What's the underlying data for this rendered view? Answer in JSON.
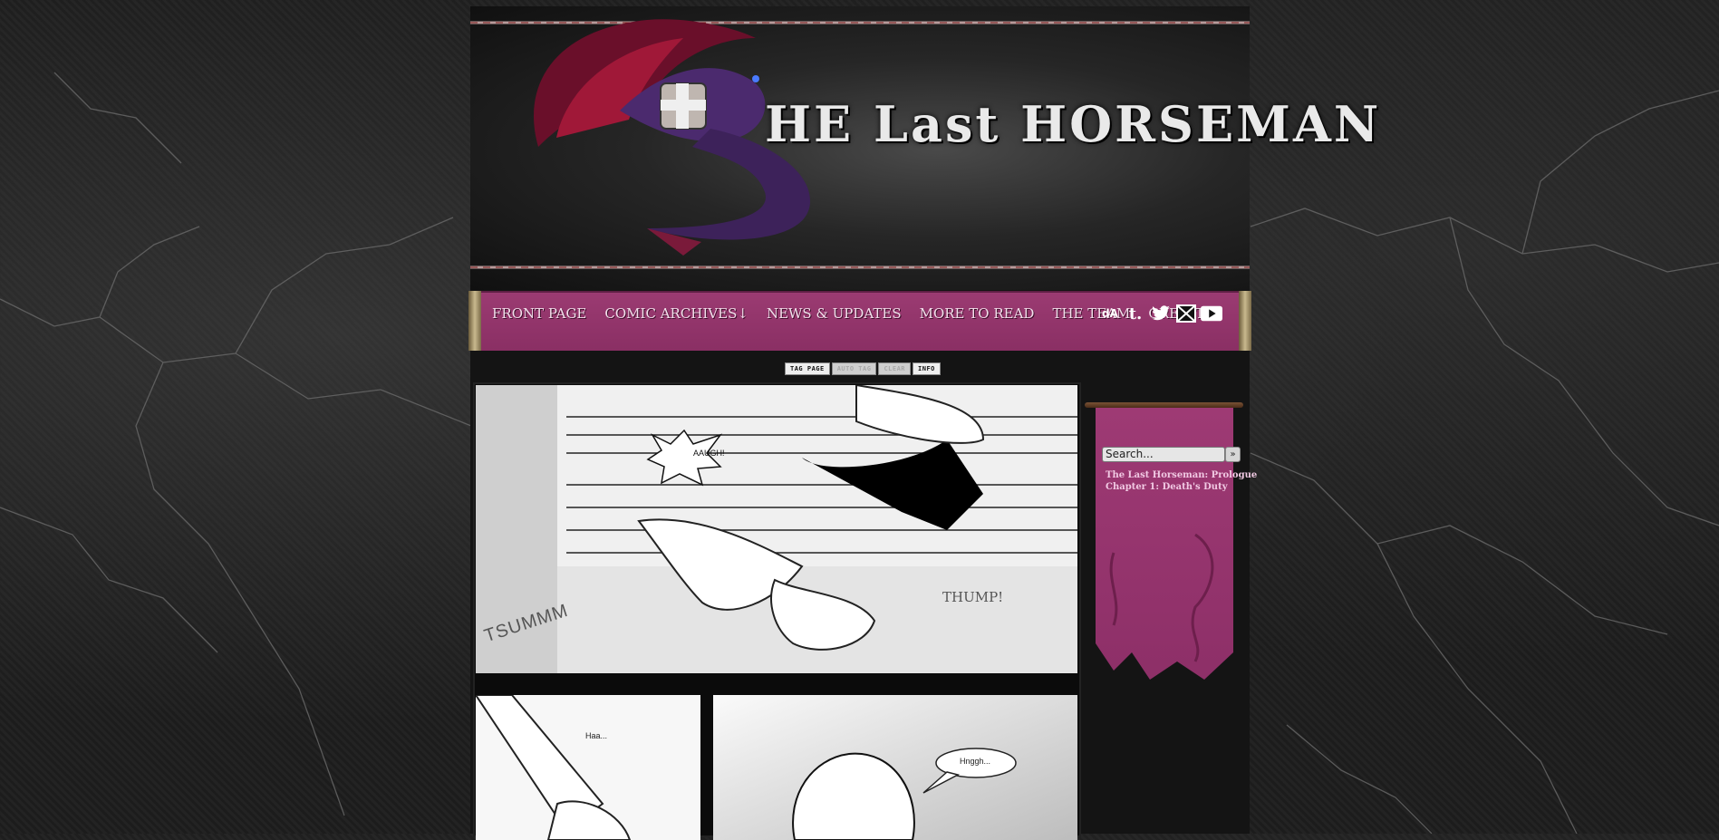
{
  "site": {
    "title": "The Last Horseman",
    "title_display": "HE Last HORSEMAN"
  },
  "nav": {
    "items": [
      {
        "label": "FRONT PAGE"
      },
      {
        "label": "COMIC ARCHIVES↓"
      },
      {
        "label": "NEWS & UPDATES"
      },
      {
        "label": "MORE TO READ"
      },
      {
        "label": "THE TEAM"
      },
      {
        "label": "CREDITS"
      }
    ],
    "social": [
      {
        "icon": "deviantart-icon",
        "glyph": "dA"
      },
      {
        "icon": "tumblr-icon",
        "glyph": "t."
      },
      {
        "icon": "twitter-icon",
        "glyph": "🐦"
      },
      {
        "icon": "email-icon",
        "glyph": "✉"
      },
      {
        "icon": "youtube-icon",
        "glyph": "▶"
      }
    ]
  },
  "comic_nav": {
    "buttons": [
      {
        "label": "TAG PAGE",
        "state": "active"
      },
      {
        "label": "AUTO TAG",
        "state": "disabled"
      },
      {
        "label": "CLEAR",
        "state": "disabled"
      },
      {
        "label": "INFO",
        "state": "active"
      }
    ]
  },
  "comic": {
    "sfx": {
      "aaugh": "AAUGH!",
      "tsummm": "TSUMMM",
      "thump": "THUMP!",
      "haa": "Haa...",
      "hnggh": "Hnggh..."
    }
  },
  "sidebar": {
    "search_placeholder": "Search...",
    "search_button": "»",
    "links": [
      {
        "label": "The Last Horseman: Prologue"
      },
      {
        "label": "Chapter 1: Death's Duty"
      }
    ]
  },
  "colors": {
    "accent": "#8f3168",
    "nav_text": "#f3e0ec",
    "background": "#1e1e1e"
  }
}
